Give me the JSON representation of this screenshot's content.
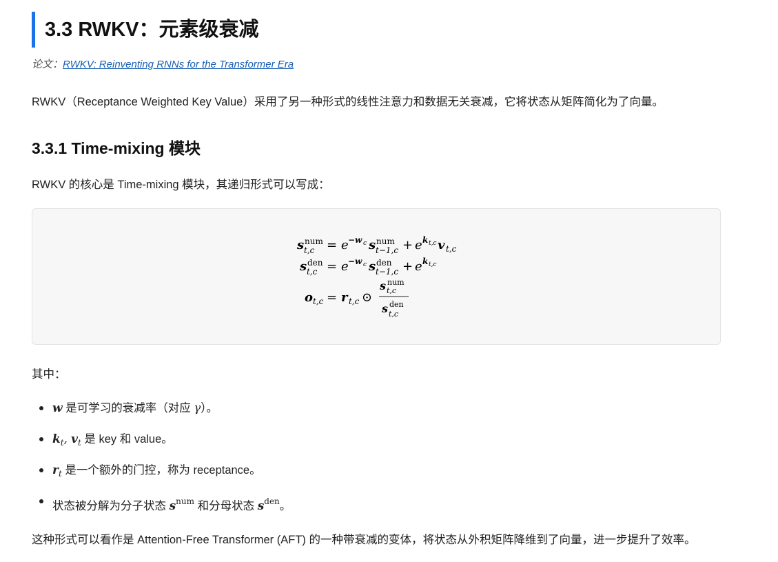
{
  "section": {
    "title": "3.3 RWKV：元素级衰减",
    "paper_prefix": "论文：",
    "paper_link": "RWKV: Reinventing RNNs for the Transformer Era",
    "intro": "RWKV（Receptance Weighted Key Value）采用了另一种形式的线性注意力和数据无关衰减，它将状态从矩阵简化为了向量。"
  },
  "subsection": {
    "title": "3.3.1 Time-mixing 模块",
    "intro": "RWKV 的核心是 Time-mixing 模块，其递归形式可以写成："
  },
  "equation": {
    "line1": {
      "lhs": "s",
      "lhs_sup": "num",
      "lhs_sub": "t,c",
      "eq": "=",
      "e": "e",
      "exp": "−w",
      "exp_sub": "c",
      "s": "s",
      "s_sup": "num",
      "s_sub": "t−1,c",
      "plus": "+",
      "e2": "e",
      "exp2": "k",
      "exp2_sub": "t,c",
      "v": "v",
      "v_sub": "t,c"
    },
    "line2": {
      "lhs": "s",
      "lhs_sup": "den",
      "lhs_sub": "t,c",
      "eq": "=",
      "e": "e",
      "exp": "−w",
      "exp_sub": "c",
      "s": "s",
      "s_sup": "den",
      "s_sub": "t−1,c",
      "plus": "+",
      "e2": "e",
      "exp2": "k",
      "exp2_sub": "t,c"
    },
    "line3": {
      "lhs": "o",
      "lhs_sub": "t,c",
      "eq": "=",
      "r": "r",
      "r_sub": "t,c",
      "odot": "⊙",
      "num": "s",
      "num_sup": "num",
      "num_sub": "t,c",
      "den": "s",
      "den_sup": "den",
      "den_sub": "t,c"
    }
  },
  "where_label": "其中：",
  "items": [
    {
      "sym": "w",
      "text": " 是可学习的衰减率（对应 ",
      "greek": "γ",
      "tail": "）。"
    },
    {
      "sym1": "k",
      "sub1": "t",
      "comma": ", ",
      "sym2": "v",
      "sub2": "t",
      "text": " 是 key 和 value。"
    },
    {
      "sym": "r",
      "sub": "t",
      "text": " 是一个额外的门控，称为 receptance。"
    },
    {
      "pre": "状态被分解为分子状态 ",
      "sym1": "s",
      "sup1": "num",
      "mid": " 和分母状态 ",
      "sym2": "s",
      "sup2": "den",
      "tail": "。"
    }
  ],
  "closing": "这种形式可以看作是 Attention-Free Transformer (AFT) 的一种带衰减的变体，将状态从外积矩阵降维到了向量，进一步提升了效率。",
  "colors": {
    "accent": "#1a73e8",
    "link": "#1a5fb4",
    "box_bg": "#f7f7f7"
  }
}
